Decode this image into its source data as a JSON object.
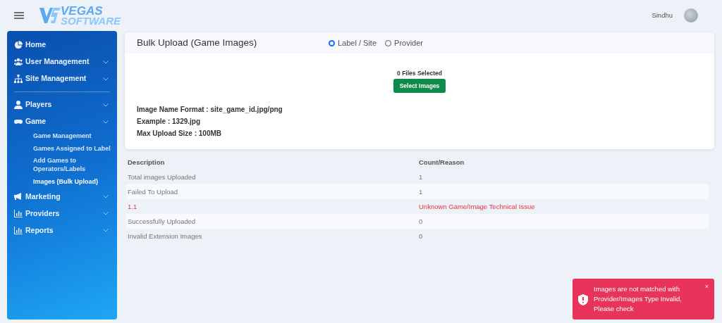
{
  "header": {
    "logo_top": "VEGAS",
    "logo_bottom": "SOFTWARE",
    "user": "Sindhu"
  },
  "sidebar": {
    "sections": [
      {
        "items": [
          {
            "label": "Home",
            "has_submenu": false
          },
          {
            "label": "User Management",
            "has_submenu": true
          },
          {
            "label": "Site Management",
            "has_submenu": true
          }
        ]
      },
      {
        "items": [
          {
            "label": "Players",
            "has_submenu": true
          },
          {
            "label": "Game",
            "has_submenu": true,
            "expanded": true,
            "children": [
              {
                "label": "Game Management",
                "selected": false
              },
              {
                "label": "Games Assigned to Label",
                "selected": false
              },
              {
                "label": "Add Games to Operators/Labels",
                "selected": false
              },
              {
                "label": "Images (Bulk Upload)",
                "selected": true
              }
            ]
          },
          {
            "label": "Marketing",
            "has_submenu": true
          },
          {
            "label": "Providers",
            "has_submenu": true
          },
          {
            "label": "Reports",
            "has_submenu": true
          }
        ]
      }
    ]
  },
  "card": {
    "title": "Bulk Upload (Game Images)",
    "radios": [
      {
        "label": "Label / Site",
        "selected": true
      },
      {
        "label": "Provider",
        "selected": false
      }
    ],
    "files_selected": "0 Files Selected",
    "button": "Select Images",
    "info": [
      "Image Name Format : site_game_id.jpg/png",
      "Example : 1329.jpg",
      "Max Upload Size : 100MB"
    ]
  },
  "table": {
    "columns": [
      "Description",
      "Count/Reason"
    ],
    "rows": [
      {
        "kind": "normal",
        "cells": [
          "Total images Uploaded",
          "1"
        ]
      },
      {
        "kind": "normal",
        "cells": [
          "Failed To Upload",
          "1"
        ]
      },
      {
        "kind": "error",
        "cells": [
          "1.1",
          "Unknown Game/Image Technical Issue"
        ]
      },
      {
        "kind": "normal",
        "cells": [
          "Successfully Uploaded",
          "0"
        ]
      },
      {
        "kind": "normal",
        "cells": [
          "Invalid Extension Images",
          "0"
        ]
      }
    ]
  },
  "toast": {
    "message": "Images are not matched with Provider/Images Type Invalid, Please check",
    "close": "×"
  }
}
